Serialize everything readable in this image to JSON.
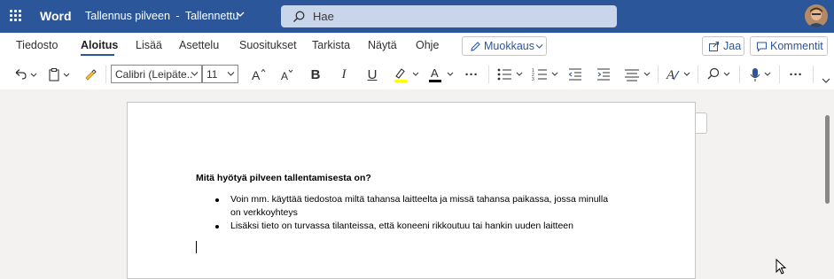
{
  "app": {
    "name": "Word",
    "document_title": "Tallennus pilveen",
    "document_status": "Tallennettu",
    "title_separator": "-"
  },
  "search": {
    "placeholder": "Hae"
  },
  "tabs": [
    {
      "label": "Tiedosto"
    },
    {
      "label": "Aloitus"
    },
    {
      "label": "Lisää"
    },
    {
      "label": "Asettelu"
    },
    {
      "label": "Suositukset"
    },
    {
      "label": "Tarkista"
    },
    {
      "label": "Näytä"
    },
    {
      "label": "Ohje"
    }
  ],
  "active_tab": "Aloitus",
  "edit_mode": {
    "label": "Muokkaus"
  },
  "share": {
    "label": "Jaa"
  },
  "comments": {
    "label": "Kommentit"
  },
  "font": {
    "name": "Calibri (Leipäte...",
    "size": "11"
  },
  "format": {
    "bold": "B",
    "italic": "I",
    "underline": "U",
    "more": "···"
  },
  "colors": {
    "brand": "#2b579a",
    "highlight": "#ffff00",
    "font_color": "#000000"
  },
  "document": {
    "heading": "Mitä hyötyä pilveen tallentamisesta on?",
    "bullets": [
      {
        "line1": "Voin mm. käyttää tiedostoa miltä tahansa laitteelta ja missä tahansa paikassa, jossa minulla",
        "line2": "on verkkoyhteys"
      },
      {
        "line1": "Lisäksi tieto on turvassa tilanteissa, että koneeni rikkoutuu tai hankin uuden laitteen",
        "line2": ""
      }
    ]
  },
  "icons": [
    "waffle-icon",
    "chevron-down-icon",
    "search-icon",
    "avatar",
    "pencil-icon",
    "share-icon",
    "comment-icon",
    "undo-icon",
    "paste-icon",
    "format-painter-icon",
    "grow-font-icon",
    "shrink-font-icon",
    "highlight-icon",
    "font-color-icon",
    "bullets-icon",
    "numbering-icon",
    "decrease-indent-icon",
    "increase-indent-icon",
    "align-icon",
    "styles-icon",
    "find-icon",
    "dictate-icon",
    "more-icon",
    "collapse-ribbon-icon",
    "mouse-pointer-icon"
  ]
}
